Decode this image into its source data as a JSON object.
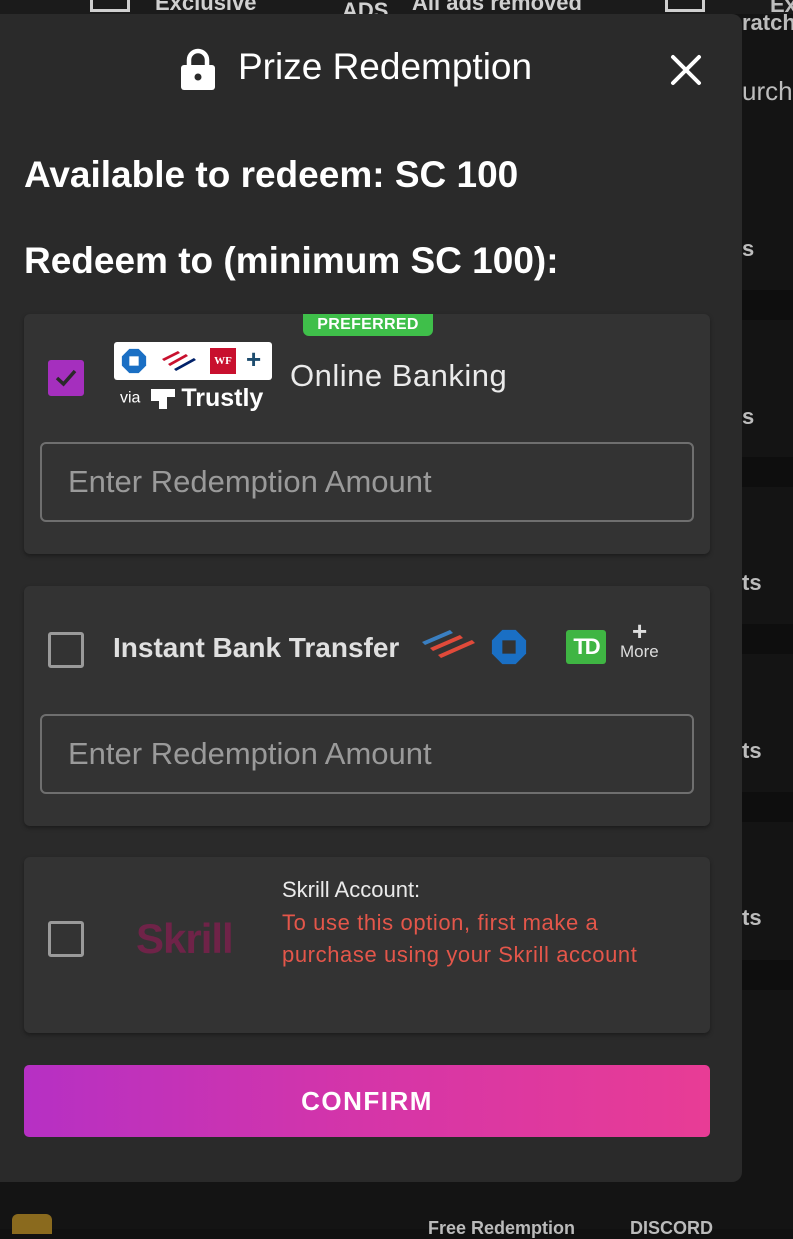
{
  "background": {
    "top_texts": [
      "Exclusive",
      "ADS",
      "All ads removed"
    ],
    "right_texts": [
      "Ex",
      "ratch",
      "urch",
      "s",
      "s",
      "ts",
      "ts",
      "ts"
    ],
    "bottom_texts": [
      "Free Redemption",
      "DISCORD"
    ]
  },
  "modal": {
    "title": "Prize Redemption",
    "lock_icon": "lock-icon",
    "close_icon": "close-icon",
    "available_text": "Available to redeem: SC 100",
    "redeem_to_text": "Redeem to (minimum SC 100):"
  },
  "options": {
    "online_banking": {
      "checked": true,
      "badge": "PREFERRED",
      "label": "Online Banking",
      "via": "via",
      "provider": "Trustly",
      "bank_logos": [
        "chase-logo",
        "bank-of-america-logo",
        "wells-fargo-logo",
        "plus-icon"
      ],
      "wf_text": "WF",
      "plus": "+",
      "input_placeholder": "Enter Redemption Amount",
      "input_value": ""
    },
    "instant_bank_transfer": {
      "checked": false,
      "label": "Instant Bank Transfer",
      "bank_logos": [
        "bank-of-america-logo",
        "chase-logo",
        "td-logo"
      ],
      "td_text": "TD",
      "more_plus": "+",
      "more_label": "More",
      "input_placeholder": "Enter Redemption Amount",
      "input_value": ""
    },
    "skrill": {
      "checked": false,
      "logo_text": "Skrill",
      "title": "Skrill Account:",
      "warning": "To use this option, first make a purchase using your Skrill account"
    }
  },
  "confirm_label": "CONFIRM",
  "colors": {
    "accent": "#a52fbe",
    "preferred": "#3fbf4a",
    "warning": "#e4564a",
    "confirm_gradient_start": "#b630c4",
    "confirm_gradient_end": "#e83c95",
    "skrill": "#6f2348"
  }
}
